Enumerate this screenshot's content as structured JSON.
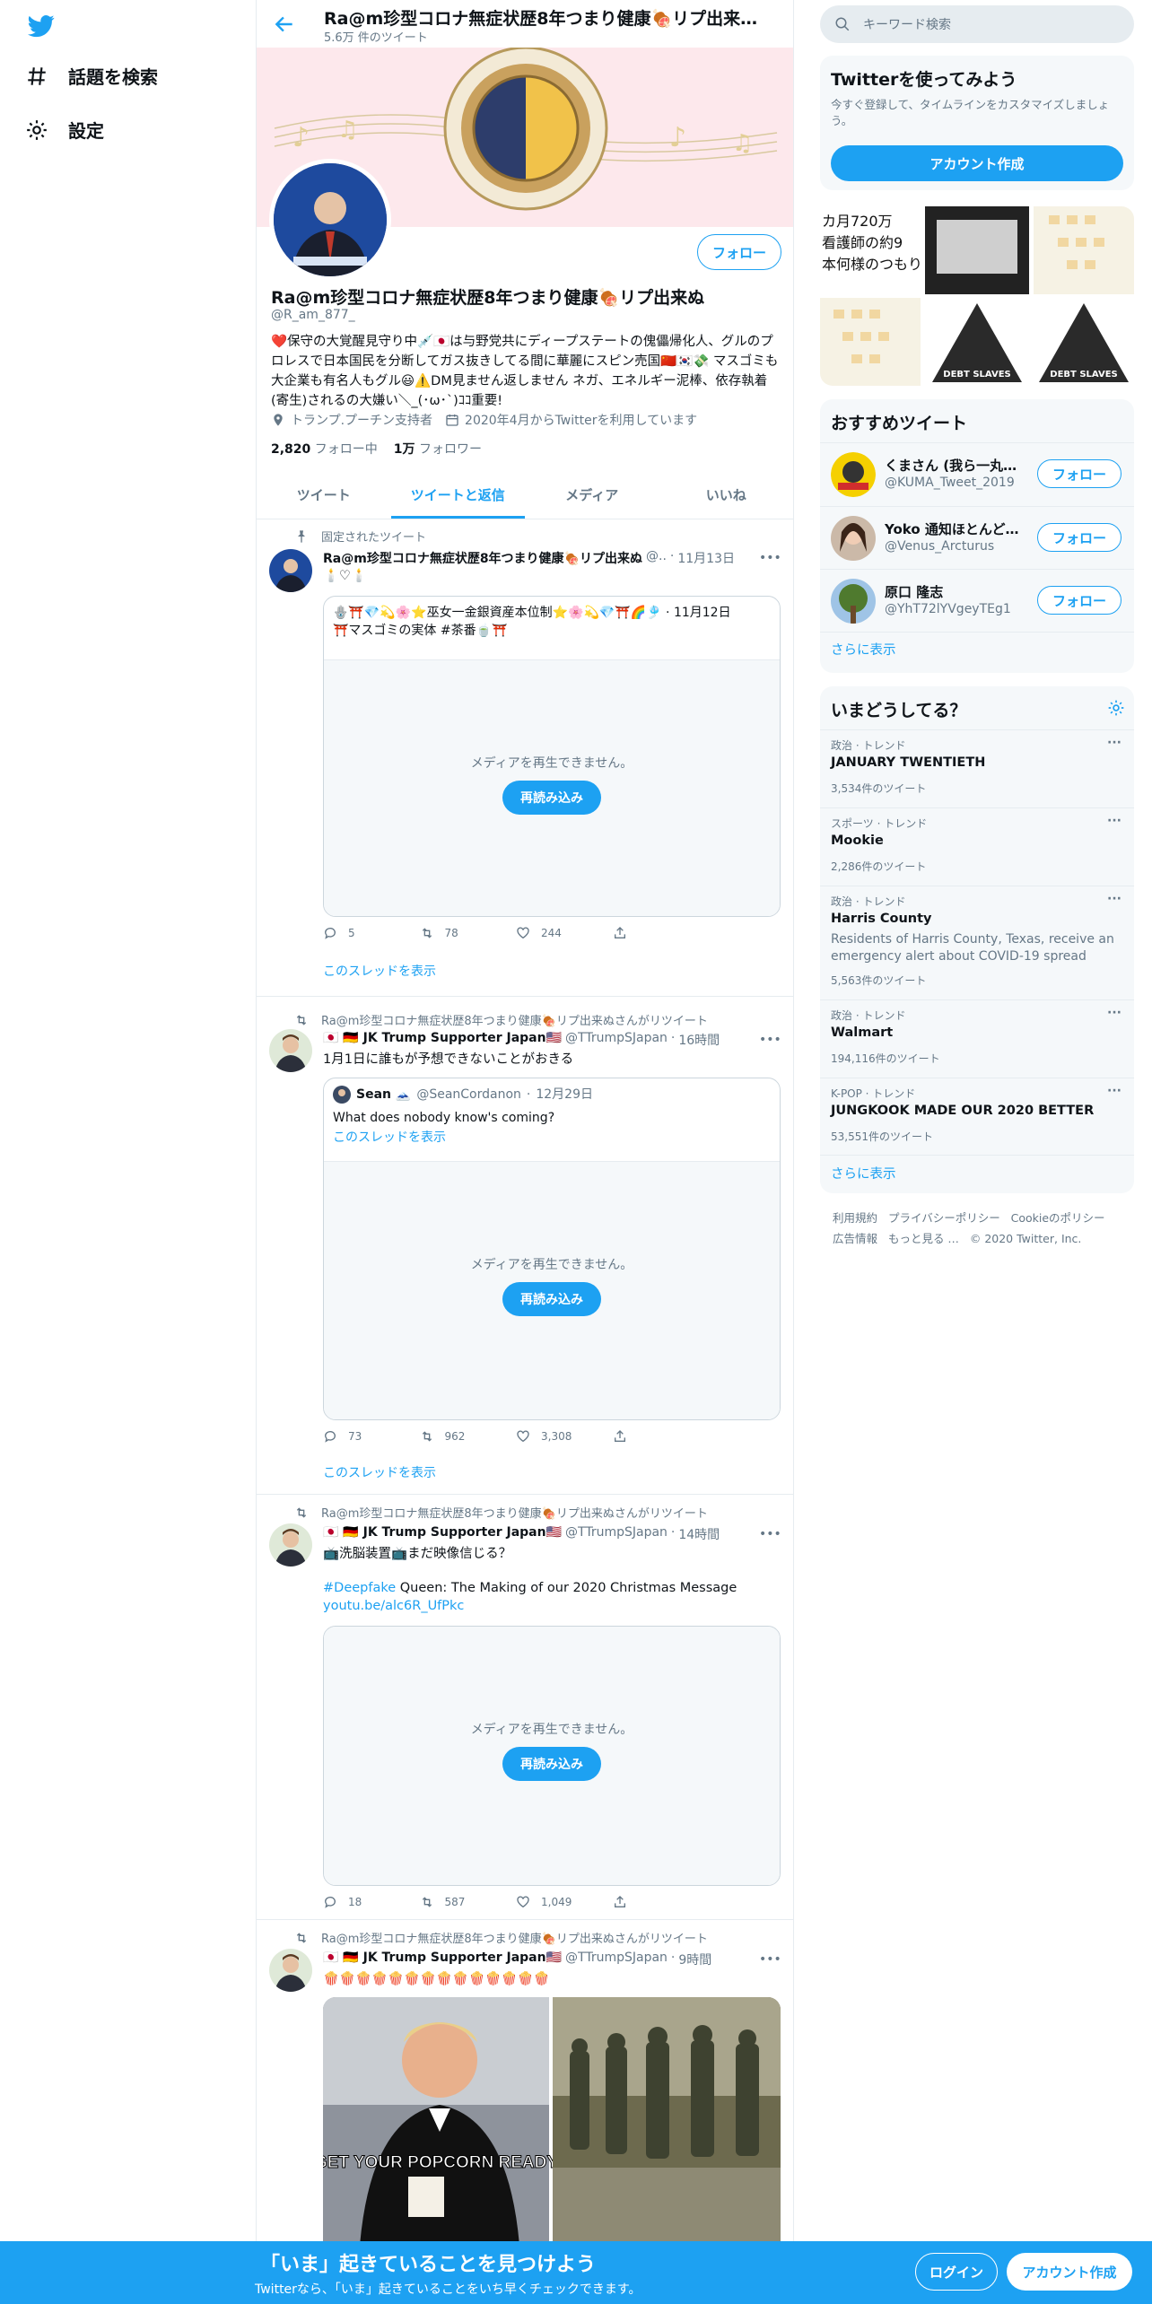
{
  "nav": {
    "items": [
      {
        "label": "話題を検索",
        "icon": "hashtag-icon"
      },
      {
        "label": "設定",
        "icon": "gear-icon"
      }
    ]
  },
  "header": {
    "title": "Ra@m珍型コロナ無症状歴8年つまり健康🍖リプ出来…",
    "tweet_count": "5.6万 件のツイート"
  },
  "profile": {
    "follow_label": "フォロー",
    "name": "Ra@m珍型コロナ無症状歴8年つまり健康🍖リプ出来ぬ",
    "handle": "@R_am_877_",
    "bio": "❤️保守の大覚醒見守り中💉🇯🇵は与野党共にディープステートの傀儡帰化人、グルのプロレスで日本国民を分断してガス抜きしてる間に華麗にスピン売国🇨🇳🇰🇷💸 マスゴミも大企業も有名人もグル😃⚠️DM見ません返しません ネガ、エネルギー泥棒、依存執着(寄生)されるの大嫌い＼_(･ω･`)ｺｺ重要!",
    "location": "トランプ.プーチン支持者",
    "joined": "2020年4月からTwitterを利用しています",
    "following_count": "2,820",
    "following_label": "フォロー中",
    "followers_count": "1万",
    "followers_label": "フォロワー"
  },
  "tabs": [
    {
      "label": "ツイート",
      "active": false
    },
    {
      "label": "ツイートと返信",
      "active": true
    },
    {
      "label": "メディア",
      "active": false
    },
    {
      "label": "いいね",
      "active": false
    }
  ],
  "media_unavailable": "メディアを再生できません。",
  "reload_label": "再読み込み",
  "thread_label": "このスレッドを表示",
  "tweets": [
    {
      "context": "固定されたツイート",
      "name": "Ra@m珍型コロナ無症状歴8年つまり健康🍖リプ出来ぬ",
      "handle": "@..",
      "time": "11月13日",
      "text": "🕯️♡🕯️",
      "quote_text": "🪬⛩️💎💫🌸⭐巫女一金銀資産本位制⭐🌸💫💎⛩️🌈🎐 · 11月12日",
      "quote_text2": "⛩️マスゴミの実体 #茶番🍵⛩️",
      "replies": "5",
      "retweets": "78",
      "likes": "244"
    },
    {
      "context": "Ra@m珍型コロナ無症状歴8年つまり健康🍖リプ出来ぬさんがリツイート",
      "name": "🇯🇵 🇩🇪 JK Trump Supporter Japan🇺🇸",
      "handle": "@TTrumpSJapan",
      "time": "16時間",
      "text": "1月1日に誰もが予想できないことがおきる",
      "quote_name": "Sean 🗻",
      "quote_handle": "@SeanCordanon",
      "quote_time": "12月29日",
      "quote_text": "What does nobody know's coming?",
      "quote_thread": "このスレッドを表示",
      "replies": "73",
      "retweets": "962",
      "likes": "3,308"
    },
    {
      "context": "Ra@m珍型コロナ無症状歴8年つまり健康🍖リプ出来ぬさんがリツイート",
      "name": "🇯🇵 🇩🇪 JK Trump Supporter Japan🇺🇸",
      "handle": "@TTrumpSJapan",
      "time": "14時間",
      "text": "📺洗脳装置📺まだ映像信じる？",
      "hashtag": "#Deepfake",
      "text2": " Queen: The Making of our 2020 Christmas Message",
      "link": "youtu.be/alc6R_UfPkc",
      "replies": "18",
      "retweets": "587",
      "likes": "1,049"
    },
    {
      "context": "Ra@m珍型コロナ無症状歴8年つまり健康🍖リプ出来ぬさんがリツイート",
      "name": "🇯🇵 🇩🇪 JK Trump Supporter Japan🇺🇸",
      "handle": "@TTrumpSJapan",
      "time": "9時間",
      "text": "🍿🍿🍿🍿🍿🍿🍿🍿🍿🍿🍿🍿🍿🍿",
      "image_caption": "GET YOUR POPCORN READY"
    }
  ],
  "right": {
    "search_placeholder": "キーワード検索",
    "signup_card": {
      "title": "Twitterを使ってみよう",
      "desc": "今すぐ登録して、タイムラインをカスタマイズしましょう。",
      "button": "アカウント作成"
    },
    "media_grid_text": [
      "カ月720万",
      "看護師の約9",
      "本何様のつもり"
    ],
    "media_grid_labels": [
      "DEBT SLAVES",
      "DEBT SLAVES"
    ],
    "recommend": {
      "title": "おすすめツイート",
      "users": [
        {
          "name": "くまさん (我ら一丸と…",
          "handle": "@KUMA_Tweet_2019"
        },
        {
          "name": "Yoko 通知ほとんど来…",
          "handle": "@Venus_Arcturus"
        },
        {
          "name": "原口 隆志",
          "handle": "@YhT72lYVgeyTEg1"
        }
      ],
      "follow_label": "フォロー",
      "more": "さらに表示"
    },
    "trends": {
      "title": "いまどうしてる？",
      "items": [
        {
          "category": "政治 · トレンド",
          "name": "JANUARY TWENTIETH",
          "count": "3,534件のツイート"
        },
        {
          "category": "スポーツ · トレンド",
          "name": "Mookie",
          "count": "2,286件のツイート"
        },
        {
          "category": "政治 · トレンド",
          "name": "Harris County",
          "desc": "Residents of Harris County, Texas, receive an emergency alert about COVID-19 spread",
          "count": "5,563件のツイート"
        },
        {
          "category": "政治 · トレンド",
          "name": "Walmart",
          "count": "194,116件のツイート"
        },
        {
          "category": "K-POP · トレンド",
          "name": "JUNGKOOK MADE OUR 2020 BETTER",
          "count": "53,551件のツイート"
        }
      ],
      "more": "さらに表示"
    },
    "footer": {
      "links": [
        "利用規約",
        "プライバシーポリシー",
        "Cookieのポリシー",
        "広告情報",
        "もっと見る …"
      ],
      "copyright": "© 2020 Twitter, Inc."
    }
  },
  "bottom_bar": {
    "title": "「いま」起きていることを見つけよう",
    "subtitle": "Twitterなら、「いま」起きていることをいち早くチェックできます。",
    "login": "ログイン",
    "signup": "アカウント作成"
  },
  "colors": {
    "accent": "#1da1f2",
    "secondary_text": "#657786",
    "border": "#e6ecf0"
  }
}
